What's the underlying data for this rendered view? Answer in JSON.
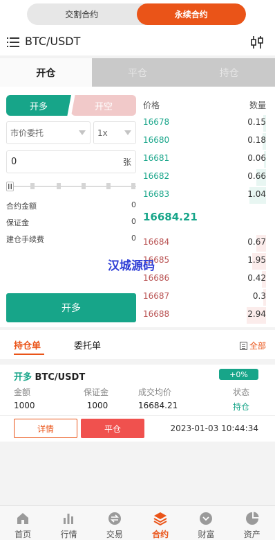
{
  "top_switch": {
    "delivery": "交割合约",
    "perpetual": "永续合约"
  },
  "header": {
    "pair": "BTC/USDT",
    "menu_icon": "menu-icon",
    "settings_icon": "candlestick-settings-icon"
  },
  "sub_tabs": [
    "开仓",
    "平仓",
    "持仓"
  ],
  "order_form": {
    "long_label": "开多",
    "short_label": "开空",
    "order_type": "市价委托",
    "leverage": "1x",
    "quantity_value": "0",
    "quantity_unit": "张",
    "slider_percent": 0,
    "contract_amount_label": "合约金额",
    "contract_amount_value": "0",
    "margin_label": "保证金",
    "margin_value": "0",
    "fee_label": "建仓手续费",
    "fee_value": "0",
    "submit_label": "开多"
  },
  "orderbook": {
    "price_header": "价格",
    "qty_header": "数量",
    "buys": [
      {
        "price": "16678",
        "qty": "0.15"
      },
      {
        "price": "16680",
        "qty": "0.18"
      },
      {
        "price": "16681",
        "qty": "0.06"
      },
      {
        "price": "16682",
        "qty": "0.66"
      },
      {
        "price": "16683",
        "qty": "1.04"
      }
    ],
    "mid_price": "16684.21",
    "sells": [
      {
        "price": "16684",
        "qty": "0.67"
      },
      {
        "price": "16685",
        "qty": "1.95"
      },
      {
        "price": "16686",
        "qty": "0.42"
      },
      {
        "price": "16687",
        "qty": "0.3"
      },
      {
        "price": "16688",
        "qty": "2.94"
      }
    ]
  },
  "watermark": "汉城源码",
  "orders": {
    "tab_positions": "持仓单",
    "tab_entrusted": "委托单",
    "all_label": "全部",
    "position": {
      "direction": "开多",
      "pair": "BTC/USDT",
      "pnl_badge": "+0%",
      "amount_label": "金额",
      "amount_value": "1000",
      "margin_label": "保证金",
      "margin_value": "1000",
      "price_label": "成交均价",
      "price_value": "16684.21",
      "status_label": "状态",
      "status_value": "持仓",
      "detail_label": "详情",
      "close_label": "平仓",
      "time": "2023-01-03 10:44:34"
    }
  },
  "bottom_nav": [
    {
      "label": "首页",
      "icon": "home-icon"
    },
    {
      "label": "行情",
      "icon": "bar-chart-icon"
    },
    {
      "label": "交易",
      "icon": "exchange-icon"
    },
    {
      "label": "合约",
      "icon": "layers-icon"
    },
    {
      "label": "财富",
      "icon": "wallet-icon"
    },
    {
      "label": "资产",
      "icon": "pie-icon"
    }
  ],
  "colors": {
    "accent": "#ea5418",
    "buy": "#17a589",
    "sell": "#b85050",
    "close_button": "#f0514e"
  }
}
